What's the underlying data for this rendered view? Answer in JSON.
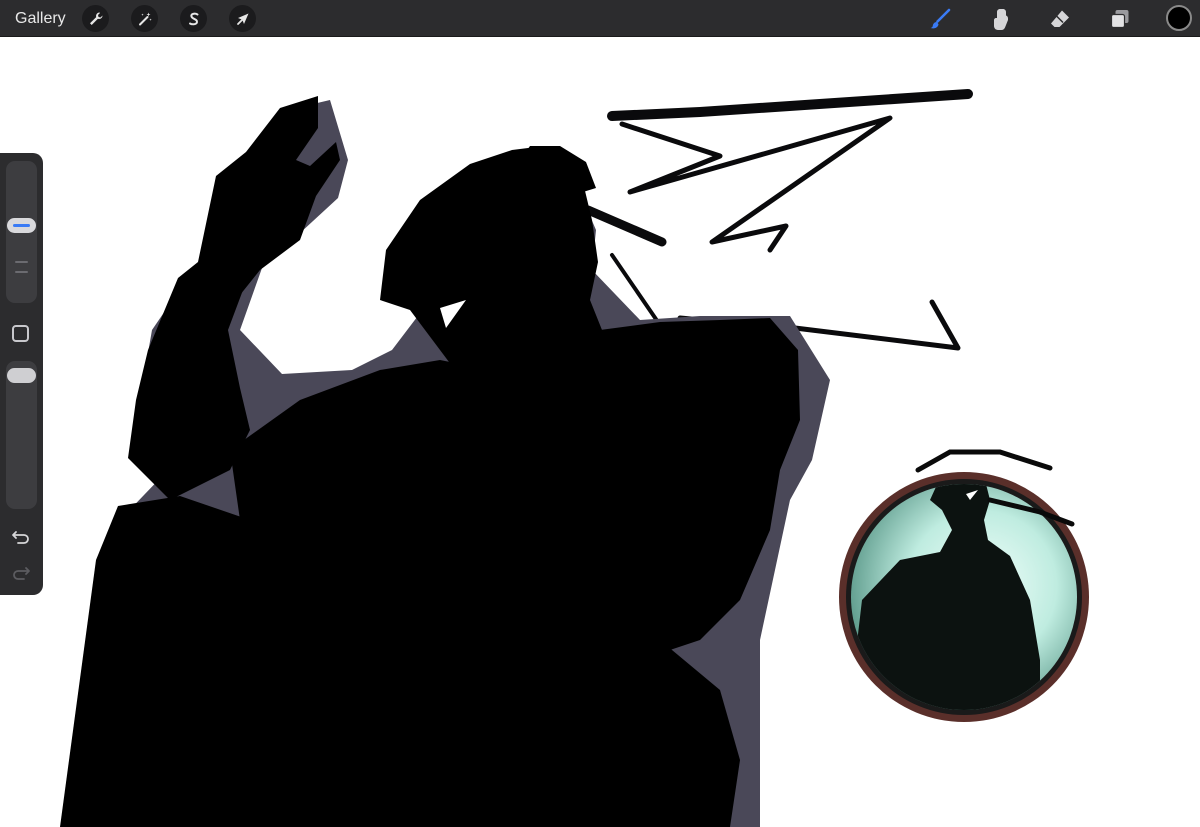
{
  "topbar": {
    "gallery_label": "Gallery",
    "left_tools": [
      {
        "icon": "wrench-icon",
        "name": "actions"
      },
      {
        "icon": "magic-wand-icon",
        "name": "adjustments"
      },
      {
        "icon": "selection-s-icon",
        "name": "selection"
      },
      {
        "icon": "arrow-cursor-icon",
        "name": "transform"
      }
    ],
    "right_tools": [
      {
        "icon": "brush-icon",
        "name": "paint",
        "active": true
      },
      {
        "icon": "smudge-icon",
        "name": "smudge"
      },
      {
        "icon": "eraser-icon",
        "name": "eraser"
      },
      {
        "icon": "layers-icon",
        "name": "layers"
      }
    ],
    "current_color": "#000000",
    "active_tool_color": "#3a7bf5"
  },
  "sidebar": {
    "size_slider_level": 0.55,
    "opacity_slider_level": 0.95,
    "icons": [
      "modify-square-icon",
      "undo-icon",
      "redo-icon"
    ]
  },
  "colors": {
    "bar_background": "#2c2c2e",
    "canvas_background": "#ffffff",
    "silhouette": "#000000",
    "rim_shadow": "#4a4858",
    "emblem_glow": "#bfece0",
    "emblem_ring": "#5a2f2a",
    "accent": "#3a7bf5"
  }
}
